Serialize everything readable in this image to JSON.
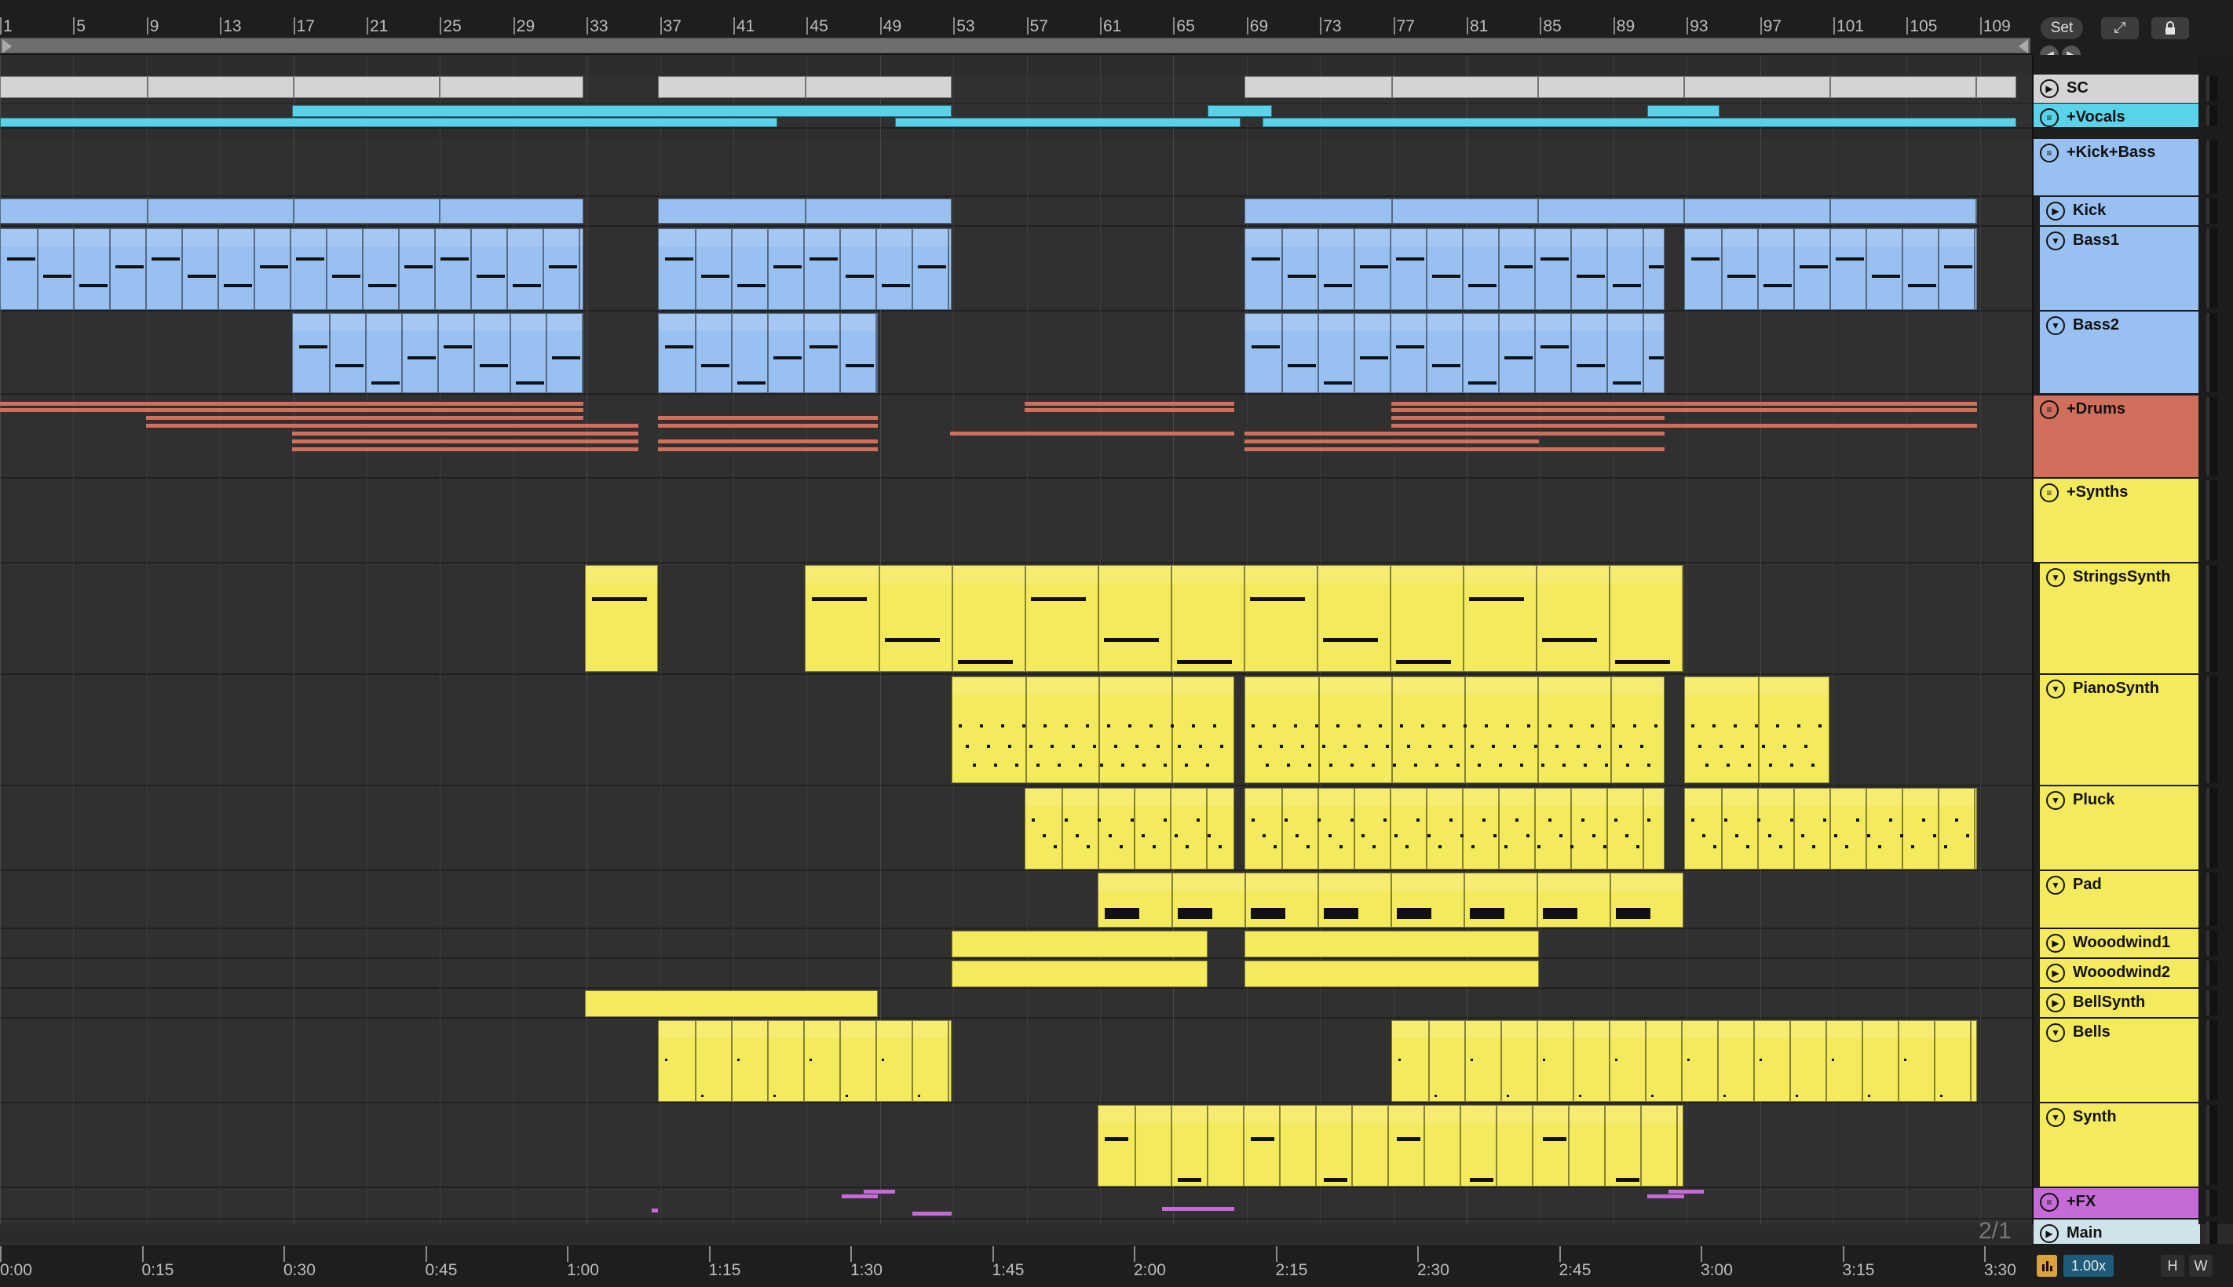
{
  "ruler": {
    "bar_labels": [
      "1",
      "5",
      "9",
      "13",
      "17",
      "21",
      "25",
      "29",
      "33",
      "37",
      "41",
      "45",
      "49",
      "53",
      "57",
      "61",
      "65",
      "69",
      "73",
      "77",
      "81",
      "85",
      "89",
      "93",
      "97",
      "101",
      "105",
      "109"
    ]
  },
  "timeline": {
    "labels": [
      "0:00",
      "0:15",
      "0:30",
      "0:45",
      "1:00",
      "1:15",
      "1:30",
      "1:45",
      "2:00",
      "2:15",
      "2:30",
      "2:45",
      "3:00",
      "3:15",
      "3:30"
    ],
    "grid_ratio": "2/1"
  },
  "top_right": {
    "set_label": "Set",
    "expand_icon": "expand-diagonal-icon",
    "lock_icon": "lock-icon",
    "back_icon": "arrow-left-icon",
    "forward_icon": "arrow-right-icon"
  },
  "tracks": [
    {
      "name": "SC",
      "kind": "midi",
      "icon": "play-triangle-icon",
      "color": "#d4d4d4"
    },
    {
      "name": "+Vocals",
      "kind": "group",
      "icon": "group-lines-icon",
      "color": "#59d3ea"
    },
    {
      "name": "+Kick+Bass",
      "kind": "group",
      "icon": "group-lines-icon",
      "color": "#98c1f2"
    },
    {
      "name": "Kick",
      "kind": "midi",
      "icon": "play-triangle-icon",
      "color": "#98c1f2"
    },
    {
      "name": "Bass1",
      "kind": "midi",
      "icon": "fold-triangle-icon",
      "color": "#98c1f2"
    },
    {
      "name": "Bass2",
      "kind": "midi",
      "icon": "fold-triangle-icon",
      "color": "#98c1f2"
    },
    {
      "name": "+Drums",
      "kind": "group",
      "icon": "group-lines-icon",
      "color": "#d16f5d"
    },
    {
      "name": "+Synths",
      "kind": "group",
      "icon": "group-lines-icon",
      "color": "#f4ea5e"
    },
    {
      "name": "StringsSynth",
      "kind": "midi",
      "icon": "fold-triangle-icon",
      "color": "#f4ea5e"
    },
    {
      "name": "PianoSynth",
      "kind": "midi",
      "icon": "fold-triangle-icon",
      "color": "#f4ea5e"
    },
    {
      "name": "Pluck",
      "kind": "midi",
      "icon": "fold-triangle-icon",
      "color": "#f4ea5e"
    },
    {
      "name": "Pad",
      "kind": "midi",
      "icon": "fold-triangle-icon",
      "color": "#f4ea5e"
    },
    {
      "name": "Wooodwind1",
      "kind": "midi",
      "icon": "play-triangle-icon",
      "color": "#f4ea5e"
    },
    {
      "name": "Wooodwind2",
      "kind": "midi",
      "icon": "play-triangle-icon",
      "color": "#f4ea5e"
    },
    {
      "name": "BellSynth",
      "kind": "midi",
      "icon": "play-triangle-icon",
      "color": "#f4ea5e"
    },
    {
      "name": "Bells",
      "kind": "midi",
      "icon": "fold-triangle-icon",
      "color": "#f4ea5e"
    },
    {
      "name": "Synth",
      "kind": "midi",
      "icon": "fold-triangle-icon",
      "color": "#f4ea5e"
    },
    {
      "name": "+FX",
      "kind": "group",
      "icon": "group-lines-icon",
      "color": "#c66ad7"
    },
    {
      "name": "Main",
      "kind": "main",
      "icon": "play-triangle-icon",
      "color": "#cfe3ea"
    }
  ],
  "bottom_right": {
    "cpu_icon": "cpu-meter-icon",
    "zoom_value": "1.00x",
    "h_label": "H",
    "w_label": "W"
  },
  "colors": {
    "background": "#2b2b2b",
    "ruler": "#1e1e1e",
    "vocals": "#59d3ea",
    "bass": "#98c1f2",
    "drums": "#d16f5d",
    "synths": "#f4ea5e",
    "fx": "#c66ad7",
    "sc": "#d4d4d4",
    "main": "#cfe3ea"
  }
}
